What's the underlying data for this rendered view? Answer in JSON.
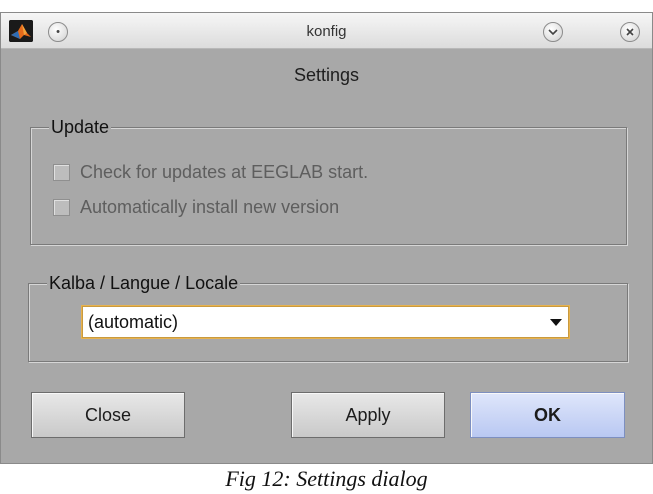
{
  "window": {
    "title": "konfig",
    "app_icon": "matlab-logo-icon",
    "controls": {
      "menu_icon": "circle-dot-icon",
      "minimize_icon": "chevron-down-icon",
      "close_icon": "close-icon"
    }
  },
  "dialog": {
    "heading": "Settings",
    "update_group": {
      "legend": "Update",
      "options": [
        {
          "label": "Check for updates at EEGLAB start.",
          "checked": false,
          "enabled": false
        },
        {
          "label": "Automatically install new version",
          "checked": false,
          "enabled": false
        }
      ]
    },
    "locale_group": {
      "legend": "Kalba / Langue / Locale",
      "selected": "(automatic)"
    },
    "buttons": {
      "close": "Close",
      "apply": "Apply",
      "ok": "OK"
    }
  },
  "caption": "Fig 12: Settings dialog",
  "colors": {
    "dialog_bg": "#a8a8a8",
    "ok_button": "#c8d4f6",
    "select_focus": "#e7b24f"
  }
}
